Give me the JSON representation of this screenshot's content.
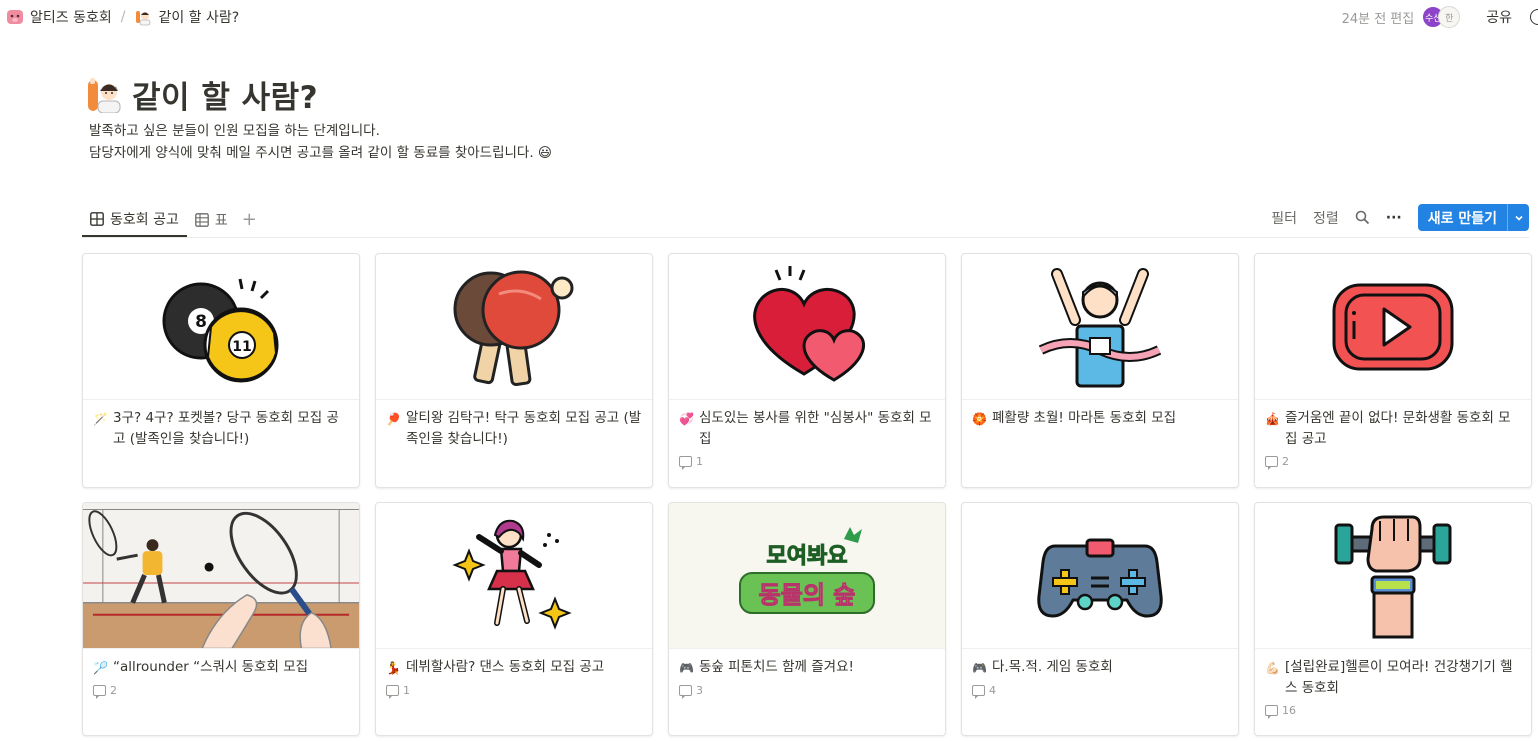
{
  "breadcrumb": {
    "workspace": "알티즈 동호회",
    "separator": "/",
    "page": "같이 할 사람?"
  },
  "top_right": {
    "edited": "24분 전 편집",
    "avatar1": "수선",
    "avatar2": "한",
    "share": "공유"
  },
  "page": {
    "title": "같이 할 사람?",
    "description_line1": "발족하고 싶은 분들이 인원 모집을 하는 단계입니다.",
    "description_line2": "담당자에게 양식에 맞춰 메일 주시면 공고를 올려 같이 할 동료를 찾아드립니다. 😃"
  },
  "views": {
    "tab1": "동호회 공고",
    "tab2": "표",
    "add": "+"
  },
  "toolbar": {
    "filter": "필터",
    "sort": "정렬",
    "more": "···",
    "new": "새로 만들기",
    "caret": "⌄"
  },
  "cards": [
    {
      "emoji": "🪄",
      "title": "3구? 4구? 포켓볼? 당구 동호회 모집 공고 (발족인을 찾습니다!)",
      "comments": ""
    },
    {
      "emoji": "🏓",
      "title": "알티왕 김탁구! 탁구 동호회 모집 공고 (발족인을 찾습니다!)",
      "comments": ""
    },
    {
      "emoji": "💞",
      "title": "심도있는 봉사를 위한 \"심봉사\" 동호회 모집",
      "comments": "1"
    },
    {
      "emoji": "🏵️",
      "title": "폐활량 초월! 마라톤 동호회 모집",
      "comments": ""
    },
    {
      "emoji": "🎪",
      "title": "즐거움엔 끝이 없다! 문화생활 동호회 모집 공고",
      "comments": "2"
    },
    {
      "emoji": "🏸",
      "title": "“allrounder “스쿼시 동호회 모집",
      "comments": "2"
    },
    {
      "emoji": "💃",
      "title": "데뷔할사람? 댄스 동호회 모집 공고",
      "comments": "1"
    },
    {
      "emoji": "🎮",
      "title": "동숲 피톤치드 함께 즐겨요!",
      "comments": "3"
    },
    {
      "emoji": "🎮",
      "title": "다.목.적. 게임 동호회",
      "comments": "4"
    },
    {
      "emoji": "💪🏻",
      "title": "[설립완료]헬른이 모여라! 건강챙기기 헬스 동호회",
      "comments": "16"
    }
  ],
  "animal_crossing_logo": {
    "line1": "모여봐요",
    "line2": "동물의 숲"
  },
  "colors": {
    "accent": "#2383e2",
    "text": "#37352f",
    "muted": "#9b9a97"
  }
}
